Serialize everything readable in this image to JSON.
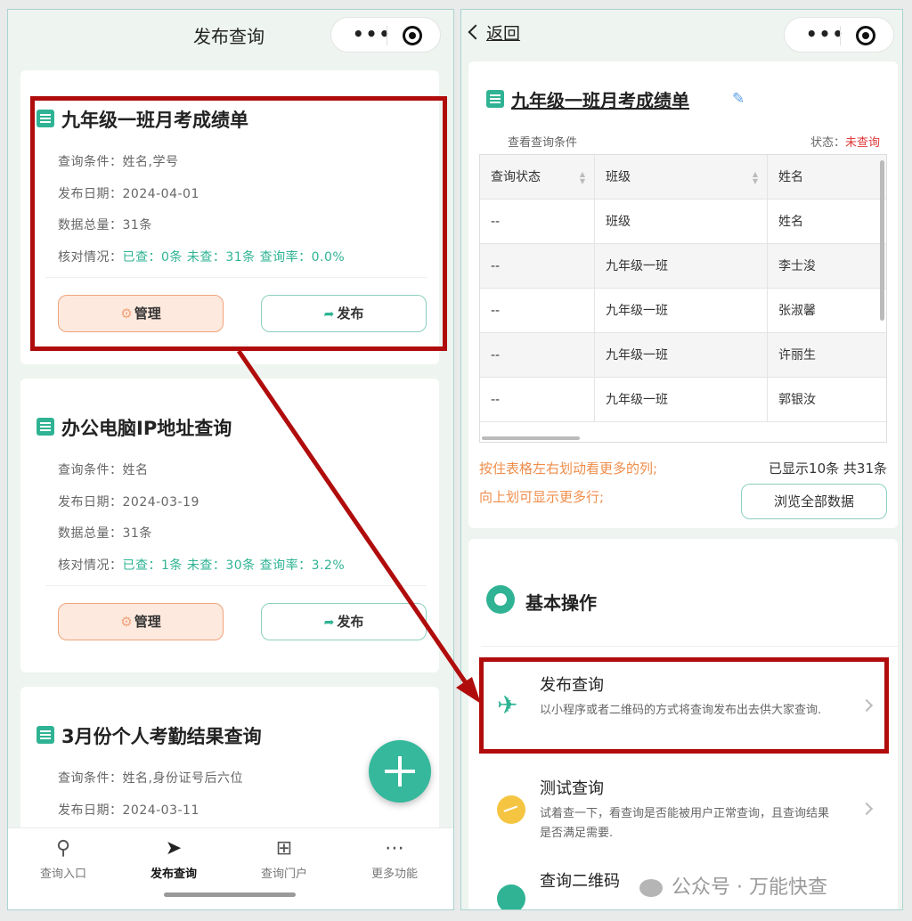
{
  "left": {
    "header_title": "发布查询",
    "capsule_dots": "•••",
    "cards": [
      {
        "title": "九年级一班月考成绩单",
        "cond_label": "查询条件：",
        "cond_value": "姓名,学号",
        "date_label": "发布日期：",
        "date_value": "2024-04-01",
        "total_label": "数据总量：",
        "total_value": "31条",
        "check_label": "核对情况：",
        "check_value": "已查：0条 未查：31条 查询率：0.0%",
        "manage": "管理",
        "publish": "发布"
      },
      {
        "title": "办公电脑IP地址查询",
        "cond_label": "查询条件：",
        "cond_value": "姓名",
        "date_label": "发布日期：",
        "date_value": "2024-03-19",
        "total_label": "数据总量：",
        "total_value": "31条",
        "check_label": "核对情况：",
        "check_value": "已查：1条 未查：30条 查询率：3.2%",
        "manage": "管理",
        "publish": "发布"
      },
      {
        "title": "3月份个人考勤结果查询",
        "cond_label": "查询条件：",
        "cond_value": "姓名,身份证号后六位",
        "date_label": "发布日期：",
        "date_value": "2024-03-11"
      }
    ],
    "tabs": [
      {
        "label": "查询入口",
        "icon": "search-icon"
      },
      {
        "label": "发布查询",
        "icon": "send-icon"
      },
      {
        "label": "查询门户",
        "icon": "sitemap-icon"
      },
      {
        "label": "更多功能",
        "icon": "more-icon"
      }
    ]
  },
  "right": {
    "back_label": "返回",
    "title": "九年级一班月考成绩单",
    "cond_link": "查看查询条件",
    "status_label": "状态：",
    "status_value": "未查询",
    "table": {
      "headers": [
        "查询状态",
        "班级",
        "姓名"
      ],
      "rows": [
        [
          "--",
          "班级",
          "姓名"
        ],
        [
          "--",
          "九年级一班",
          "李士浚"
        ],
        [
          "--",
          "九年级一班",
          "张淑馨"
        ],
        [
          "--",
          "九年级一班",
          "许丽生"
        ],
        [
          "--",
          "九年级一班",
          "郭银汝"
        ]
      ]
    },
    "hint1": "按住表格左右划动看更多的列;",
    "hint2": "向上划可显示更多行;",
    "shown_text": "已显示10条 共31条",
    "browse_all": "浏览全部数据",
    "ops_title": "基本操作",
    "ops": [
      {
        "title": "发布查询",
        "desc": "以小程序或者二维码的方式将查询发布出去供大家查询.",
        "icon": "paper-plane-icon"
      },
      {
        "title": "测试查询",
        "desc": "试着查一下，看查询是否能被用户正常查询，且查询结果是否满足需要.",
        "icon": "test-icon"
      },
      {
        "title": "查询二维码",
        "desc": "",
        "icon": "qr-icon"
      }
    ]
  },
  "watermark": "公众号 · 万能快查",
  "colors": {
    "accent": "#2fb394",
    "annotation": "#b00c0c",
    "manage_bg": "#fde9dd",
    "warning": "#ef8d4a",
    "status_red": "#e03a3a"
  }
}
